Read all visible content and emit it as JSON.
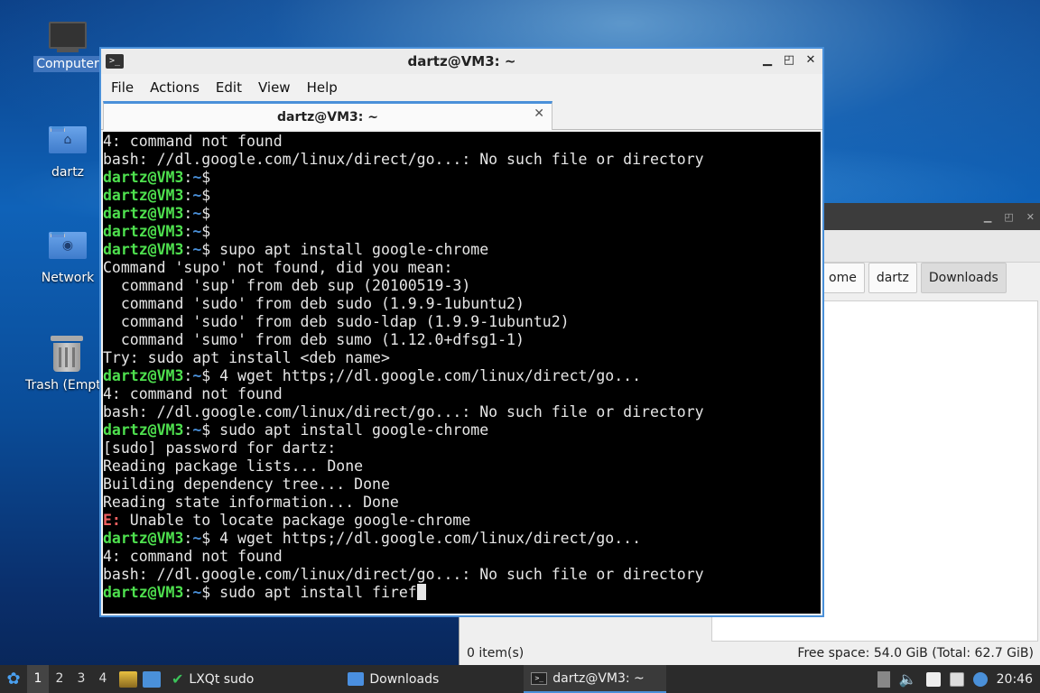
{
  "desktop": {
    "icons": [
      {
        "label": "Computer"
      },
      {
        "label": "dartz"
      },
      {
        "label": "Network"
      },
      {
        "label": "Trash (Empt"
      }
    ]
  },
  "file_manager": {
    "path_segments": [
      "ome",
      "dartz",
      "Downloads"
    ],
    "status_left": "0 item(s)",
    "status_right": "Free space: 54.0 GiB (Total: 62.7 GiB)"
  },
  "terminal": {
    "window_title": "dartz@VM3: ~",
    "menu": [
      "File",
      "Actions",
      "Edit",
      "View",
      "Help"
    ],
    "tab_label": "dartz@VM3: ~",
    "user": "dartz@VM3",
    "path": "~",
    "lines": [
      {
        "text": "4: command not found"
      },
      {
        "text": "bash: //dl.google.com/linux/direct/go...: No such file or directory"
      },
      {
        "prompt": true,
        "cmd": ""
      },
      {
        "prompt": true,
        "cmd": ""
      },
      {
        "prompt": true,
        "cmd": ""
      },
      {
        "prompt": true,
        "cmd": ""
      },
      {
        "prompt": true,
        "cmd": " supo apt install google-chrome"
      },
      {
        "text": "Command 'supo' not found, did you mean:"
      },
      {
        "text": "  command 'sup' from deb sup (20100519-3)"
      },
      {
        "text": "  command 'sudo' from deb sudo (1.9.9-1ubuntu2)"
      },
      {
        "text": "  command 'sudo' from deb sudo-ldap (1.9.9-1ubuntu2)"
      },
      {
        "text": "  command 'sumo' from deb sumo (1.12.0+dfsg1-1)"
      },
      {
        "text": "Try: sudo apt install <deb name>"
      },
      {
        "prompt": true,
        "cmd": " 4 wget https;//dl.google.com/linux/direct/go..."
      },
      {
        "text": "4: command not found"
      },
      {
        "text": "bash: //dl.google.com/linux/direct/go...: No such file or directory"
      },
      {
        "prompt": true,
        "cmd": " sudo apt install google-chrome"
      },
      {
        "text": "[sudo] password for dartz:"
      },
      {
        "text": "Reading package lists... Done"
      },
      {
        "text": "Building dependency tree... Done"
      },
      {
        "text": "Reading state information... Done"
      },
      {
        "err": "E:",
        "text": " Unable to locate package google-chrome"
      },
      {
        "prompt": true,
        "cmd": " 4 wget https;//dl.google.com/linux/direct/go..."
      },
      {
        "text": "4: command not found"
      },
      {
        "text": "bash: //dl.google.com/linux/direct/go...: No such file or directory"
      },
      {
        "prompt": true,
        "cmd": " sudo apt install firef",
        "cursor": true
      }
    ]
  },
  "taskbar": {
    "desktops": [
      "1",
      "2",
      "3",
      "4"
    ],
    "tasks": [
      {
        "label": "LXQt sudo"
      },
      {
        "label": "Downloads"
      },
      {
        "label": "dartz@VM3: ~"
      }
    ],
    "clock": "20:46"
  },
  "colors": {
    "accent": "#4a90d9",
    "prompt_user": "#4ee04e",
    "error": "#f06060"
  }
}
